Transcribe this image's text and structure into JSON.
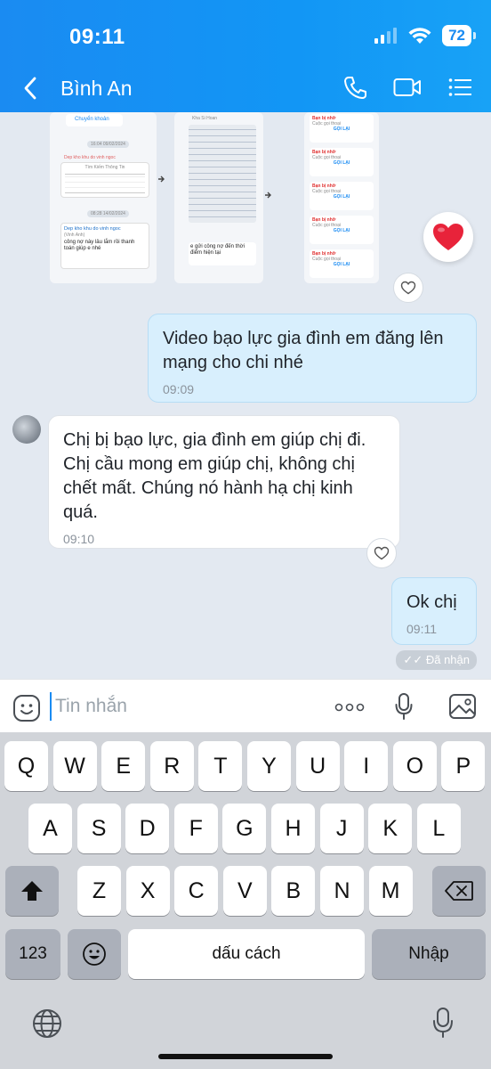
{
  "status_bar": {
    "time": "09:11",
    "battery": "72"
  },
  "header": {
    "contact_name": "Bình An"
  },
  "shared_media": {
    "transfer_label": "Chuyển khoản",
    "date_1": "16:04 09/02/2024",
    "note_label": "Dep kho khu do vinh ngoc",
    "table_title": "Tìm Kiếm Thông Tin",
    "date_2": "08:28 14/02/2024",
    "debt_title": "Dep kho khu do vinh ngoc",
    "debt_sub": "(Vinh Anh)",
    "debt_text": "công nợ này lâu lắm rồi thanh toán giúp e nhé",
    "sender_label": "Kha Si Hoan",
    "photo_caption": "e gửi công nợ đến thời điểm hiện tại",
    "missed_call": "Bạn bị nhỡ",
    "call_type": "Cuộc gọi thoại",
    "call_back": "GỌI LẠI"
  },
  "messages": [
    {
      "direction": "out",
      "text": "Video bạo lực gia đình em đăng lên mạng cho chi nhé",
      "time": "09:09"
    },
    {
      "direction": "in",
      "text": "Chị bị bạo lực, gia đình em giúp chị đi. Chị cầu mong em giúp chị, không chị chết mất. Chúng nó hành hạ chị kinh quá.",
      "time": "09:10"
    },
    {
      "direction": "out",
      "text": "Ok chị",
      "time": "09:11"
    }
  ],
  "seen_status": "Đã nhận",
  "composer": {
    "placeholder": "Tin nhắn"
  },
  "keyboard": {
    "row1": [
      "Q",
      "W",
      "E",
      "R",
      "T",
      "Y",
      "U",
      "I",
      "O",
      "P"
    ],
    "row2": [
      "A",
      "S",
      "D",
      "F",
      "G",
      "H",
      "J",
      "K",
      "L"
    ],
    "row3": [
      "Z",
      "X",
      "C",
      "V",
      "B",
      "N",
      "M"
    ],
    "numbers_key": "123",
    "space_key": "dấu cách",
    "return_key": "Nhập"
  }
}
